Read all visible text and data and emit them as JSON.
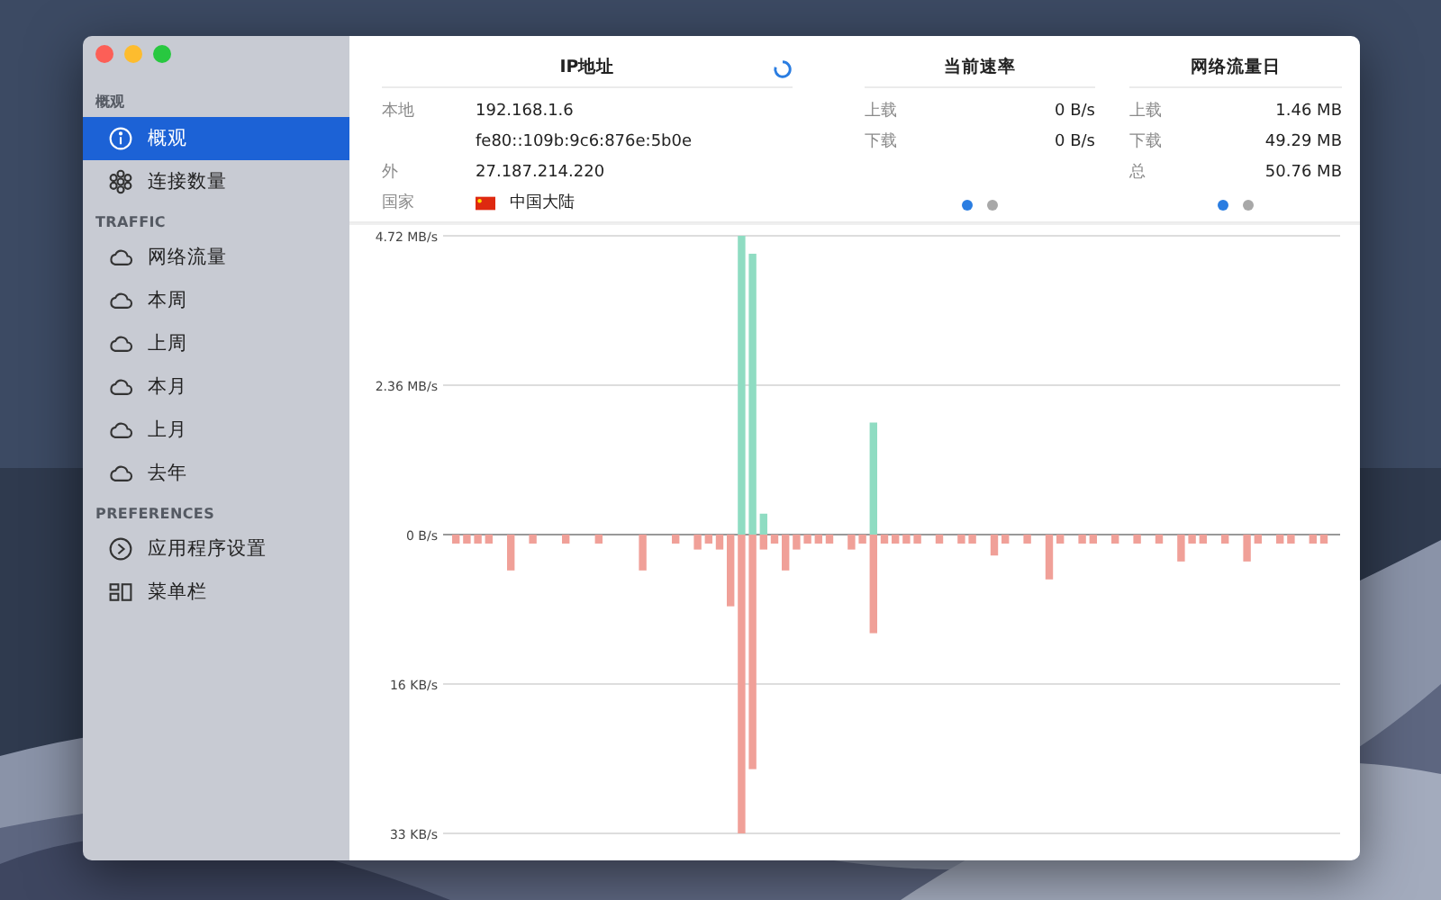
{
  "sidebar": {
    "sections": [
      {
        "title": "概观",
        "items": [
          {
            "label": "概观",
            "kind": "info",
            "selected": true
          },
          {
            "label": "连接数量",
            "kind": "cluster",
            "selected": false
          }
        ]
      },
      {
        "title": "TRAFFIC",
        "items": [
          {
            "label": "网络流量",
            "kind": "cloud",
            "selected": false
          },
          {
            "label": "本周",
            "kind": "cloud",
            "selected": false
          },
          {
            "label": "上周",
            "kind": "cloud",
            "selected": false
          },
          {
            "label": "本月",
            "kind": "cloud",
            "selected": false
          },
          {
            "label": "上月",
            "kind": "cloud",
            "selected": false
          },
          {
            "label": "去年",
            "kind": "cloud",
            "selected": false
          }
        ]
      },
      {
        "title": "PREFERENCES",
        "items": [
          {
            "label": "应用程序设置",
            "kind": "app",
            "selected": false
          },
          {
            "label": "菜单栏",
            "kind": "menubar",
            "selected": false
          }
        ]
      }
    ]
  },
  "ip_panel": {
    "title": "IP地址",
    "rows": [
      {
        "label": "本地",
        "value": "192.168.1.6"
      },
      {
        "value": "fe80::109b:9c6:876e:5b0e"
      },
      {
        "label": "外",
        "value": "27.187.214.220"
      },
      {
        "label": "国家",
        "value": "中国大陆",
        "flag": true
      }
    ]
  },
  "rate_panel": {
    "title": "当前速率",
    "rows": [
      {
        "label": "上载",
        "value": "0 B/s"
      },
      {
        "label": "下载",
        "value": "0 B/s"
      }
    ],
    "pages": [
      {
        "selected": true
      },
      {
        "selected": false
      }
    ]
  },
  "daily_panel": {
    "title": "网络流量日",
    "rows": [
      {
        "label": "上载",
        "value": "1.46 MB"
      },
      {
        "label": "下载",
        "value": "49.29 MB"
      },
      {
        "label": "总",
        "value": "50.76 MB"
      }
    ],
    "pages": [
      {
        "selected": true
      },
      {
        "selected": false
      }
    ]
  },
  "traffic_chart": {
    "y_axis_labels": [
      "4.72 MB/s",
      "2.36 MB/s",
      "0 B/s",
      "16 KB/s",
      "33 KB/s"
    ]
  }
}
